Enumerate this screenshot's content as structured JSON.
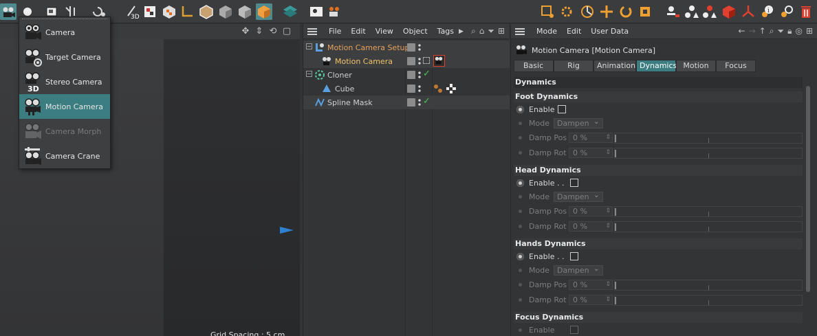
{
  "toolbar": {
    "icons": [
      "camera-icon",
      "light-icon",
      "render-region-icon",
      "arrows-icon",
      "undo-icon",
      "paint-3d-icon",
      "texture-icon",
      "axis-icon",
      "box-icon",
      "checker-box-icon",
      "cube-solid-icon",
      "cube-orange-icon",
      "grid-icon",
      "render-view-icon",
      "render-settings-icon",
      "square-select-icon",
      "gear-orange-icon",
      "rotate-orange-icon",
      "move-orange-icon",
      "refresh-orange-icon",
      "scale-orange-icon",
      "user-icon",
      "shapes-icon",
      "shapes-red-icon",
      "cube-red-icon",
      "fork-red-icon",
      "info-icon",
      "link-icon",
      "trash-icon"
    ]
  },
  "viewport": {
    "grid_spacing": "Grid Spacing : 5 cm"
  },
  "camera_menu": {
    "items": [
      {
        "label": "Camera",
        "icon": "camera-icon",
        "state": "normal"
      },
      {
        "label": "Target Camera",
        "icon": "target-camera-icon",
        "state": "normal"
      },
      {
        "label": "Stereo Camera",
        "icon": "stereo-camera-icon",
        "state": "normal"
      },
      {
        "label": "Motion Camera",
        "icon": "motion-camera-icon",
        "state": "active"
      },
      {
        "label": "Camera Morph",
        "icon": "camera-morph-icon",
        "state": "disabled"
      },
      {
        "label": "Camera Crane",
        "icon": "camera-crane-icon",
        "state": "normal"
      }
    ]
  },
  "object_manager": {
    "menu": [
      "File",
      "Edit",
      "View",
      "Object",
      "Tags"
    ],
    "objects": [
      {
        "name": "Motion Camera Setup",
        "color": "#e8a05a",
        "indent": 0
      },
      {
        "name": "Motion Camera",
        "color": "#f2c26a",
        "indent": 1
      },
      {
        "name": "Cloner",
        "color": "#d0d0d0",
        "indent": 0
      },
      {
        "name": "Cube",
        "color": "#d0d0d0",
        "indent": 1
      },
      {
        "name": "Spline Mask",
        "color": "#d0d0d0",
        "indent": 0
      }
    ]
  },
  "attribute_manager": {
    "menu": [
      "Mode",
      "Edit",
      "User Data"
    ],
    "title": "Motion Camera [Motion Camera]",
    "tabs": [
      "Basic",
      "Rig",
      "Animation",
      "Dynamics",
      "Motion",
      "Focus"
    ],
    "active_tab": "Dynamics",
    "section": "Dynamics",
    "groups": [
      {
        "title": "Foot Dynamics",
        "enable_label": "Enable",
        "mode_label": "Mode",
        "mode_value": "Dampen",
        "pos_label": "Damp Pos",
        "pos_value": "0 %",
        "rot_label": "Damp Rot",
        "rot_value": "0 %"
      },
      {
        "title": "Head Dynamics",
        "enable_label": "Enable . .",
        "mode_label": "Mode",
        "mode_value": "Dampen",
        "pos_label": "Damp Pos",
        "pos_value": "0 %",
        "rot_label": "Damp Rot",
        "rot_value": "0 %"
      },
      {
        "title": "Hands Dynamics",
        "enable_label": "Enable . .",
        "mode_label": "Mode",
        "mode_value": "Dampen",
        "pos_label": "Damp Pos",
        "pos_value": "0 %",
        "rot_label": "Damp Rot",
        "rot_value": "0 %"
      },
      {
        "title": "Focus Dynamics",
        "enable_label": "Enable"
      }
    ]
  }
}
